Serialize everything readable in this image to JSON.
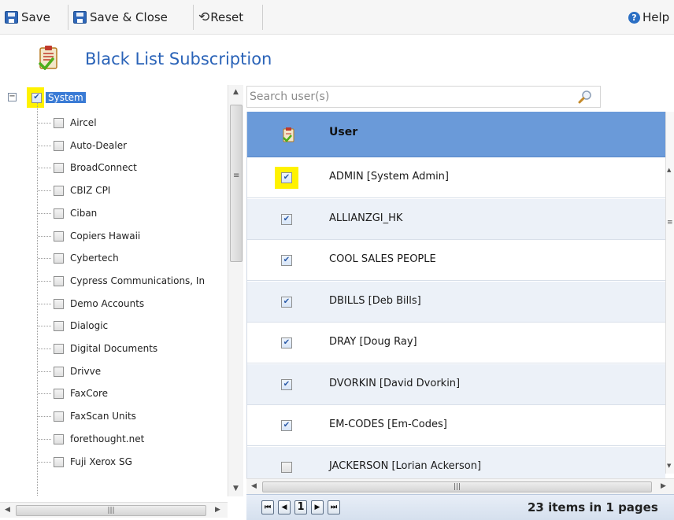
{
  "toolbar": {
    "save_label": "Save",
    "save_close_label": "Save & Close",
    "reset_label": "Reset",
    "help_label": "Help"
  },
  "page": {
    "title": "Black List Subscription"
  },
  "tree": {
    "root": {
      "label": "System",
      "checked": true
    },
    "items": [
      {
        "label": "Aircel",
        "checked": false
      },
      {
        "label": "Auto-Dealer",
        "checked": false
      },
      {
        "label": "BroadConnect",
        "checked": false
      },
      {
        "label": "CBIZ CPI",
        "checked": false
      },
      {
        "label": "Ciban",
        "checked": false
      },
      {
        "label": "Copiers Hawaii",
        "checked": false
      },
      {
        "label": "Cybertech",
        "checked": false
      },
      {
        "label": "Cypress Communications, In",
        "checked": false
      },
      {
        "label": "Demo Accounts",
        "checked": false
      },
      {
        "label": "Dialogic",
        "checked": false
      },
      {
        "label": "Digital Documents",
        "checked": false
      },
      {
        "label": "Drivve",
        "checked": false
      },
      {
        "label": "FaxCore",
        "checked": false
      },
      {
        "label": "FaxScan Units",
        "checked": false
      },
      {
        "label": "forethought.net",
        "checked": false
      },
      {
        "label": "Fuji Xerox SG",
        "checked": false
      }
    ]
  },
  "search": {
    "placeholder": "Search user(s)"
  },
  "grid": {
    "columns": {
      "user": "User"
    },
    "rows": [
      {
        "user": "ADMIN [System Admin]",
        "checked": true
      },
      {
        "user": "ALLIANZGI_HK",
        "checked": true
      },
      {
        "user": "COOL SALES PEOPLE",
        "checked": true
      },
      {
        "user": "DBILLS [Deb Bills]",
        "checked": true
      },
      {
        "user": "DRAY [Doug Ray]",
        "checked": true
      },
      {
        "user": "DVORKIN [David Dvorkin]",
        "checked": true
      },
      {
        "user": "EM-CODES [Em-Codes]",
        "checked": true
      },
      {
        "user": "JACKERSON [Lorian Ackerson]",
        "checked": false
      }
    ]
  },
  "pager": {
    "first": "◀◀",
    "prev": "◀",
    "current_page": "1",
    "next": "▶",
    "last": "▶▶",
    "info": "23 items in 1 pages"
  },
  "colors": {
    "title_blue": "#2a63b8",
    "header_blue": "#6a9ad9",
    "highlight_yellow": "#fff200",
    "selected_blue": "#3a7bd5"
  }
}
